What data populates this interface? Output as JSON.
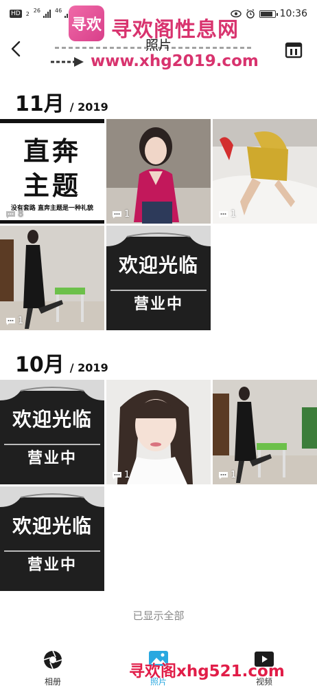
{
  "status_bar": {
    "left": {
      "hd_badge": "HD",
      "hd_sub": "2",
      "network_1": "26",
      "network_2": "46"
    },
    "time": "10:36",
    "icons": [
      "eye-comfort-icon",
      "alarm-icon",
      "battery-icon"
    ],
    "battery_level": 0.85
  },
  "watermark_top": {
    "logo_text": "寻欢",
    "name": "寻欢阁性息网",
    "url": "www.xhg2019.com"
  },
  "app_bar": {
    "title": "照片",
    "back_icon": "back-arrow-icon",
    "calendar_icon": "calendar-icon"
  },
  "sections": [
    {
      "month": "11月",
      "year": "/ 2019",
      "items": [
        {
          "kind": "text-card",
          "line1": "直奔",
          "line2": "主题",
          "caption": "没有套路 直奔主题是一种礼貌",
          "comments": "8"
        },
        {
          "kind": "photo",
          "comments": "1"
        },
        {
          "kind": "photo",
          "comments": "1"
        },
        {
          "kind": "photo",
          "comments": "1"
        },
        {
          "kind": "sign",
          "line1": "欢迎光临",
          "line2": "营业中",
          "comments": ""
        }
      ]
    },
    {
      "month": "10月",
      "year": "/ 2019",
      "items": [
        {
          "kind": "sign",
          "line1": "欢迎光临",
          "line2": "营业中",
          "comments": ""
        },
        {
          "kind": "photo",
          "comments": "1"
        },
        {
          "kind": "photo",
          "comments": "1"
        },
        {
          "kind": "sign",
          "line1": "欢迎光临",
          "line2": "营业中",
          "comments": ""
        }
      ]
    }
  ],
  "footer_note": "已显示全部",
  "bottom_nav": [
    {
      "label": "相册",
      "icon": "aperture-icon",
      "active": false
    },
    {
      "label": "照片",
      "icon": "photo-icon",
      "active": true
    },
    {
      "label": "视频",
      "icon": "video-icon",
      "active": false
    }
  ],
  "watermark_bottom": "寻欢阁xhg521.com",
  "colors": {
    "accent": "#29a8e0",
    "watermark": "#d8336e",
    "text": "#111111"
  }
}
